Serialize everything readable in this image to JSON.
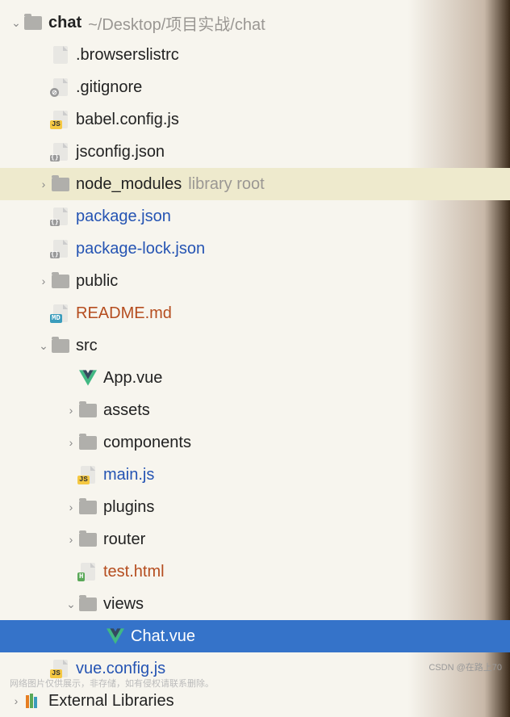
{
  "root": {
    "name": "chat",
    "path": "~/Desktop/项目实战/chat"
  },
  "items": [
    {
      "indent": 0,
      "arrow": "down",
      "icon": "folder",
      "label": "chat",
      "bold": true,
      "helper": "~/Desktop/项目实战/chat"
    },
    {
      "indent": 1,
      "arrow": "",
      "icon": "file",
      "label": ".browserslistrc"
    },
    {
      "indent": 1,
      "arrow": "",
      "icon": "ignore",
      "label": ".gitignore"
    },
    {
      "indent": 1,
      "arrow": "",
      "icon": "js",
      "label": "babel.config.js"
    },
    {
      "indent": 1,
      "arrow": "",
      "icon": "json",
      "label": "jsconfig.json"
    },
    {
      "indent": 1,
      "arrow": "right",
      "icon": "folder",
      "label": "node_modules",
      "helper": "library root",
      "highlighted": true
    },
    {
      "indent": 1,
      "arrow": "",
      "icon": "json",
      "label": "package.json",
      "link": true
    },
    {
      "indent": 1,
      "arrow": "",
      "icon": "json",
      "label": "package-lock.json",
      "link": true
    },
    {
      "indent": 1,
      "arrow": "right",
      "icon": "folder",
      "label": "public"
    },
    {
      "indent": 1,
      "arrow": "",
      "icon": "md",
      "label": "README.md",
      "orange": true
    },
    {
      "indent": 1,
      "arrow": "down",
      "icon": "folder",
      "label": "src"
    },
    {
      "indent": 2,
      "arrow": "",
      "icon": "vue",
      "label": "App.vue"
    },
    {
      "indent": 2,
      "arrow": "right",
      "icon": "folder",
      "label": "assets"
    },
    {
      "indent": 2,
      "arrow": "right",
      "icon": "folder",
      "label": "components"
    },
    {
      "indent": 2,
      "arrow": "",
      "icon": "js",
      "label": "main.js",
      "link": true
    },
    {
      "indent": 2,
      "arrow": "right",
      "icon": "folder",
      "label": "plugins"
    },
    {
      "indent": 2,
      "arrow": "right",
      "icon": "folder",
      "label": "router"
    },
    {
      "indent": 2,
      "arrow": "",
      "icon": "html",
      "label": "test.html",
      "orange": true
    },
    {
      "indent": 2,
      "arrow": "down",
      "icon": "folder",
      "label": "views"
    },
    {
      "indent": 3,
      "arrow": "",
      "icon": "vue",
      "label": "Chat.vue",
      "selected": true
    },
    {
      "indent": 1,
      "arrow": "",
      "icon": "js",
      "label": "vue.config.js",
      "link": true
    },
    {
      "indent": 0,
      "arrow": "right",
      "icon": "lib",
      "label": "External Libraries"
    }
  ],
  "watermark": "CSDN @在路上70",
  "watermark2": "网络图片仅供展示，非存储，如有侵权请联系删除。"
}
